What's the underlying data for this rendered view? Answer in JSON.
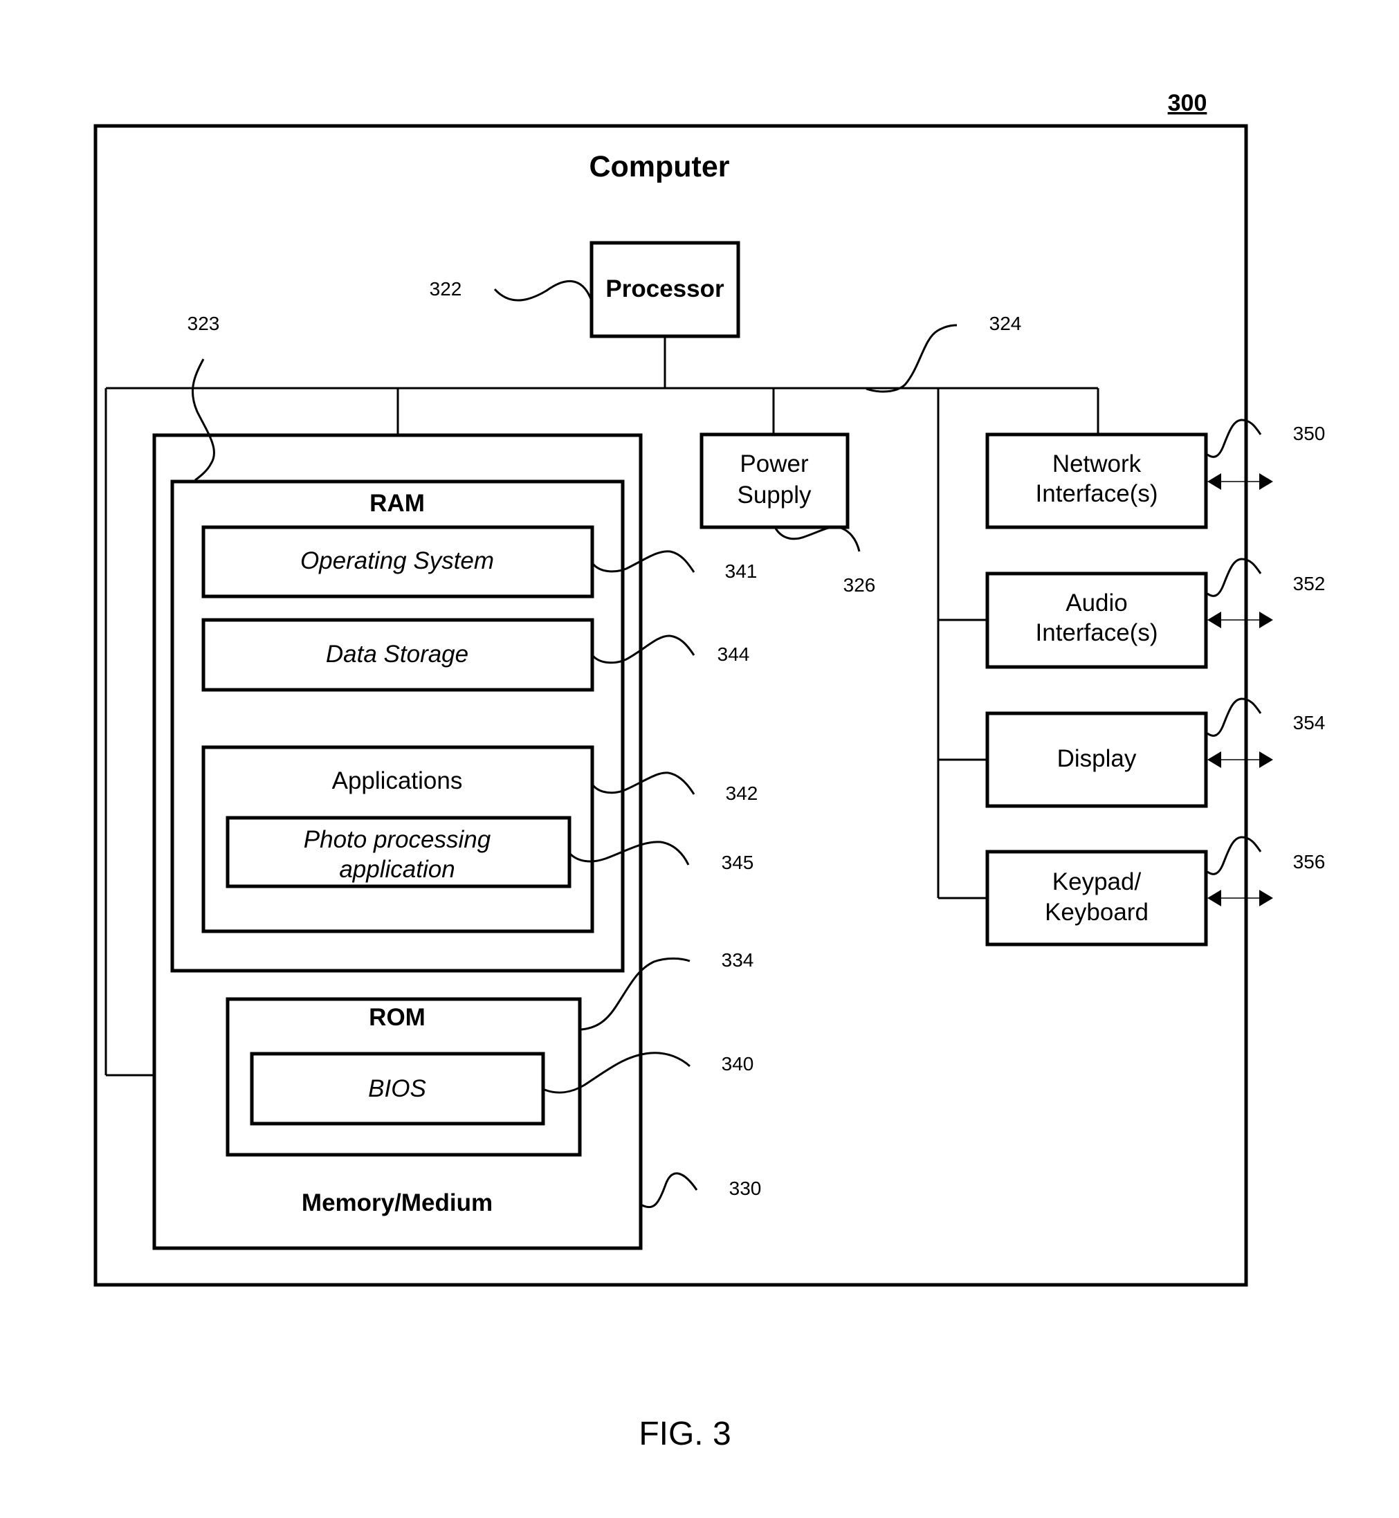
{
  "figure": {
    "number_label": "300",
    "caption": "FIG. 3"
  },
  "computer": {
    "title": "Computer"
  },
  "components": {
    "processor": {
      "label": "Processor",
      "ref": "322"
    },
    "bus": {
      "ref": "324"
    },
    "memory_bus": {
      "ref": "323"
    },
    "power_supply": {
      "label_lines": [
        "Power",
        "Supply"
      ],
      "ref": "326"
    },
    "memory": {
      "label": "Memory/Medium",
      "ref": "330",
      "ram": {
        "label": "RAM",
        "ref": "323",
        "operating_system": {
          "label": "Operating System",
          "ref": "341"
        },
        "data_storage": {
          "label": "Data Storage",
          "ref": "344"
        },
        "applications": {
          "label": "Applications",
          "ref": "342",
          "photo_processing": {
            "label_lines": [
              "Photo processing",
              "application"
            ],
            "ref": "345"
          }
        }
      },
      "rom": {
        "label": "ROM",
        "ref": "334",
        "bios": {
          "label": "BIOS",
          "ref": "340"
        }
      }
    },
    "network_interface": {
      "label_lines": [
        "Network",
        "Interface(s)"
      ],
      "ref": "350"
    },
    "audio_interface": {
      "label_lines": [
        "Audio",
        "Interface(s)"
      ],
      "ref": "352"
    },
    "display": {
      "label": "Display",
      "ref": "354"
    },
    "keypad": {
      "label_lines": [
        "Keypad/",
        "Keyboard"
      ],
      "ref": "356"
    }
  }
}
